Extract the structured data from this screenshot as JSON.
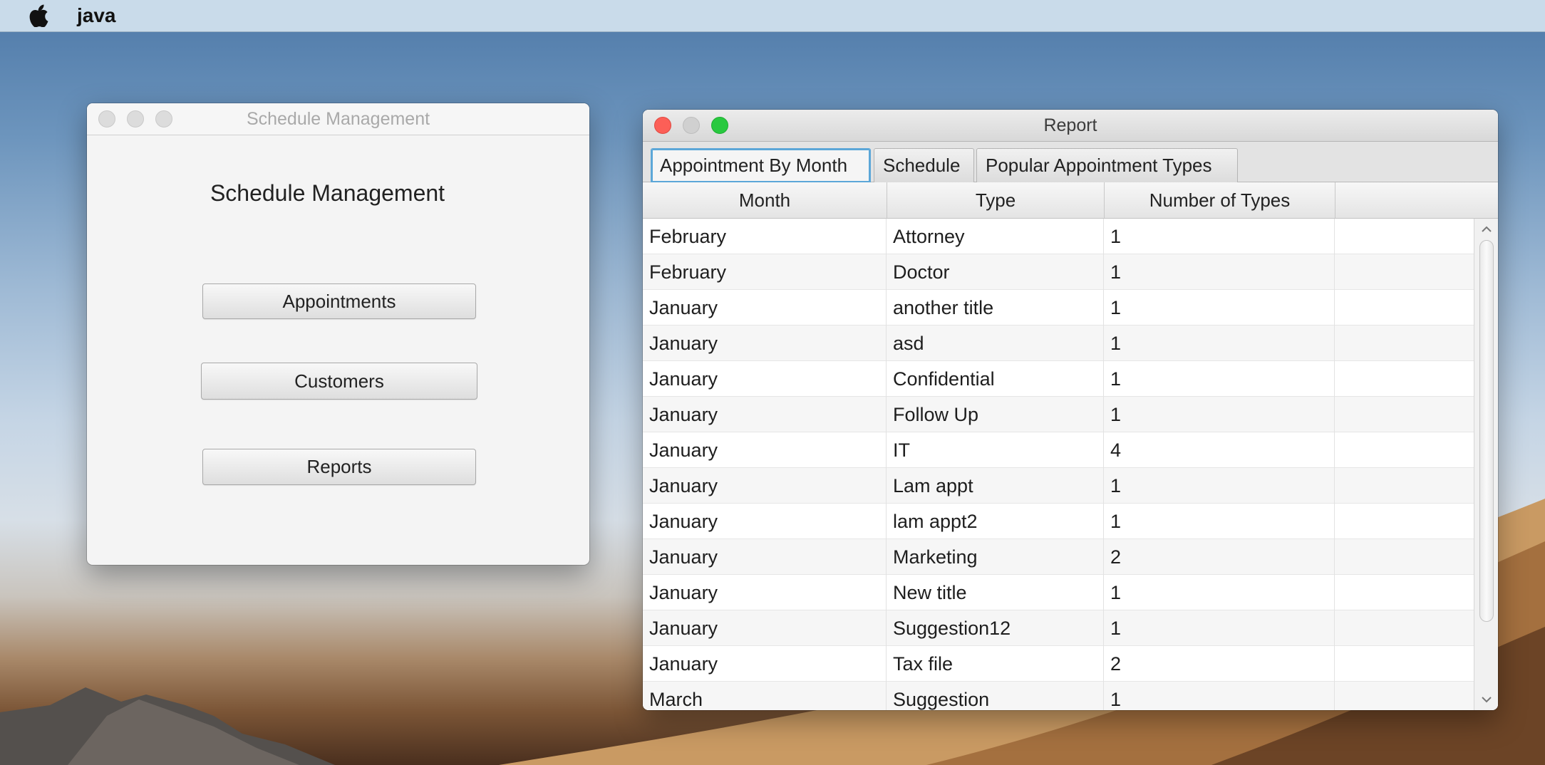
{
  "menubar": {
    "apple_icon": "apple-logo",
    "app_name": "java"
  },
  "schedule_window": {
    "title": "Schedule Management",
    "heading": "Schedule Management",
    "buttons": {
      "appointments": "Appointments",
      "customers": "Customers",
      "reports": "Reports"
    }
  },
  "report_window": {
    "title": "Report",
    "tabs": [
      {
        "label": "Appointment By Month",
        "active": true
      },
      {
        "label": "Schedule",
        "active": false
      },
      {
        "label": "Popular Appointment Types",
        "active": false
      }
    ],
    "table": {
      "columns": [
        "Month",
        "Type",
        "Number of Types",
        ""
      ],
      "rows": [
        [
          "February",
          "Attorney",
          "1"
        ],
        [
          "February",
          "Doctor",
          "1"
        ],
        [
          "January",
          "another title",
          "1"
        ],
        [
          "January",
          "asd",
          "1"
        ],
        [
          "January",
          "Confidential",
          "1"
        ],
        [
          "January",
          "Follow Up",
          "1"
        ],
        [
          "January",
          "IT",
          "4"
        ],
        [
          "January",
          "Lam appt",
          "1"
        ],
        [
          "January",
          "lam appt2",
          "1"
        ],
        [
          "January",
          "Marketing",
          "2"
        ],
        [
          "January",
          "New title",
          "1"
        ],
        [
          "January",
          "Suggestion12",
          "1"
        ],
        [
          "January",
          "Tax file",
          "2"
        ],
        [
          "March",
          "Suggestion",
          "1"
        ]
      ]
    }
  },
  "colors": {
    "close": "#fc5f57",
    "maximize": "#29c940",
    "tab_focus": "#5ca7d8"
  }
}
